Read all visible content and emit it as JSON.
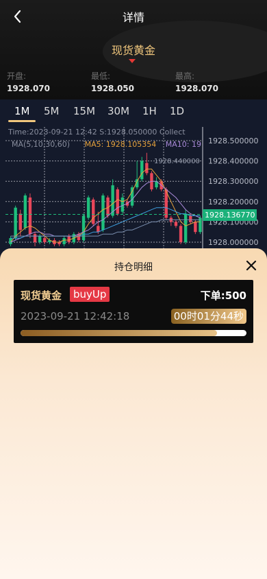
{
  "header": {
    "title": "详情",
    "product": "现货黄金",
    "stats": [
      {
        "label": "开盘:",
        "value": "1928.070"
      },
      {
        "label": "最低:",
        "value": "1928.050"
      },
      {
        "label": "最高:",
        "value": "1928.070"
      }
    ]
  },
  "timeframes": [
    "1M",
    "5M",
    "15M",
    "30M",
    "1H",
    "1D"
  ],
  "active_timeframe": "1M",
  "kline_info": "Time:2023-09-21 12:42    S:1928.050000    Collect",
  "ma_info": {
    "periods": "MA(5,10,30,60)",
    "ma5": "MA5: 1928.105354",
    "ma10": "MA10: 19"
  },
  "chart_data": {
    "type": "candlestick",
    "y_ticks": [
      "1928.500000",
      "1928.400000",
      "1928.300000",
      "1928.200000",
      "1928.100000",
      "1928.000000"
    ],
    "ylim": [
      1928.0,
      1928.5
    ],
    "current_price": "1928.136770",
    "peak_label": "1928.440000",
    "candles": [
      {
        "o": 1927.99,
        "c": 1928.02,
        "h": 1928.03,
        "l": 1927.98
      },
      {
        "o": 1928.02,
        "c": 1928.17,
        "h": 1928.18,
        "l": 1928.01
      },
      {
        "o": 1928.14,
        "c": 1928.06,
        "h": 1928.16,
        "l": 1928.03
      },
      {
        "o": 1928.07,
        "c": 1928.23,
        "h": 1928.24,
        "l": 1928.06
      },
      {
        "o": 1928.22,
        "c": 1928.04,
        "h": 1928.24,
        "l": 1928.02
      },
      {
        "o": 1928.04,
        "c": 1928.0,
        "h": 1928.05,
        "l": 1927.98
      },
      {
        "o": 1928.0,
        "c": 1928.03,
        "h": 1928.04,
        "l": 1927.99
      },
      {
        "o": 1928.02,
        "c": 1928.0,
        "h": 1928.03,
        "l": 1927.99
      },
      {
        "o": 1928.0,
        "c": 1928.01,
        "h": 1928.02,
        "l": 1927.99
      },
      {
        "o": 1928.01,
        "c": 1927.99,
        "h": 1928.02,
        "l": 1927.98
      },
      {
        "o": 1928.0,
        "c": 1927.99,
        "h": 1928.01,
        "l": 1927.98
      },
      {
        "o": 1927.99,
        "c": 1928.02,
        "h": 1928.03,
        "l": 1927.98
      },
      {
        "o": 1928.03,
        "c": 1928.0,
        "h": 1928.04,
        "l": 1927.99
      },
      {
        "o": 1928.0,
        "c": 1928.04,
        "h": 1928.05,
        "l": 1927.99
      },
      {
        "o": 1928.04,
        "c": 1928.01,
        "h": 1928.05,
        "l": 1928.0
      },
      {
        "o": 1928.01,
        "c": 1928.13,
        "h": 1928.14,
        "l": 1928.0
      },
      {
        "o": 1928.12,
        "c": 1928.22,
        "h": 1928.23,
        "l": 1928.11
      },
      {
        "o": 1928.21,
        "c": 1928.09,
        "h": 1928.22,
        "l": 1928.08
      },
      {
        "o": 1928.08,
        "c": 1928.05,
        "h": 1928.15,
        "l": 1928.04
      },
      {
        "o": 1928.06,
        "c": 1928.23,
        "h": 1928.24,
        "l": 1928.05
      },
      {
        "o": 1928.22,
        "c": 1928.13,
        "h": 1928.23,
        "l": 1928.12
      },
      {
        "o": 1928.13,
        "c": 1928.28,
        "h": 1928.31,
        "l": 1928.12
      },
      {
        "o": 1928.26,
        "c": 1928.14,
        "h": 1928.27,
        "l": 1928.13
      },
      {
        "o": 1928.15,
        "c": 1928.22,
        "h": 1928.24,
        "l": 1928.14
      },
      {
        "o": 1928.2,
        "c": 1928.18,
        "h": 1928.21,
        "l": 1928.17
      },
      {
        "o": 1928.18,
        "c": 1928.27,
        "h": 1928.28,
        "l": 1928.17
      },
      {
        "o": 1928.27,
        "c": 1928.31,
        "h": 1928.4,
        "l": 1928.26
      },
      {
        "o": 1928.31,
        "c": 1928.4,
        "h": 1928.42,
        "l": 1928.3
      },
      {
        "o": 1928.39,
        "c": 1928.34,
        "h": 1928.44,
        "l": 1928.33
      },
      {
        "o": 1928.34,
        "c": 1928.26,
        "h": 1928.35,
        "l": 1928.25
      },
      {
        "o": 1928.27,
        "c": 1928.3,
        "h": 1928.32,
        "l": 1928.26
      },
      {
        "o": 1928.3,
        "c": 1928.26,
        "h": 1928.31,
        "l": 1928.25
      },
      {
        "o": 1928.26,
        "c": 1928.12,
        "h": 1928.27,
        "l": 1928.11
      },
      {
        "o": 1928.12,
        "c": 1928.1,
        "h": 1928.13,
        "l": 1928.08
      },
      {
        "o": 1928.1,
        "c": 1928.08,
        "h": 1928.11,
        "l": 1928.07
      },
      {
        "o": 1928.08,
        "c": 1928.0,
        "h": 1928.09,
        "l": 1927.99
      },
      {
        "o": 1928.0,
        "c": 1928.14,
        "h": 1928.16,
        "l": 1927.99
      },
      {
        "o": 1928.13,
        "c": 1928.1,
        "h": 1928.14,
        "l": 1928.09
      },
      {
        "o": 1928.1,
        "c": 1928.05,
        "h": 1928.11,
        "l": 1928.04
      },
      {
        "o": 1928.05,
        "c": 1928.12,
        "h": 1928.13,
        "l": 1928.04
      }
    ],
    "ma_lines": [
      {
        "name": "MA5",
        "color": "#e6a23c",
        "values": [
          1928.0,
          1928.03,
          1928.05,
          1928.07,
          1928.08,
          1928.07,
          1928.05,
          1928.03,
          1928.01,
          1928.0,
          1928.0,
          1928.01,
          1928.01,
          1928.02,
          1928.03,
          1928.05,
          1928.09,
          1928.12,
          1928.14,
          1928.16,
          1928.17,
          1928.19,
          1928.21,
          1928.2,
          1928.21,
          1928.25,
          1928.3,
          1928.34,
          1928.36,
          1928.36,
          1928.33,
          1928.3,
          1928.25,
          1928.2,
          1928.15,
          1928.1,
          1928.08,
          1928.09,
          1928.1,
          1928.1
        ]
      },
      {
        "name": "MA10",
        "color": "#a98ad8",
        "values": [
          1928.0,
          1928.01,
          1928.02,
          1928.03,
          1928.04,
          1928.05,
          1928.05,
          1928.04,
          1928.04,
          1928.03,
          1928.03,
          1928.03,
          1928.03,
          1928.03,
          1928.04,
          1928.05,
          1928.06,
          1928.08,
          1928.1,
          1928.11,
          1928.13,
          1928.15,
          1928.17,
          1928.18,
          1928.19,
          1928.21,
          1928.24,
          1928.27,
          1928.29,
          1928.3,
          1928.3,
          1928.28,
          1928.26,
          1928.24,
          1928.22,
          1928.19,
          1928.16,
          1928.14,
          1928.13,
          1928.12
        ]
      },
      {
        "name": "MA30",
        "color": "#3fa0e0",
        "values": [
          1928.02,
          1928.02,
          1928.02,
          1928.03,
          1928.03,
          1928.03,
          1928.03,
          1928.03,
          1928.03,
          1928.03,
          1928.03,
          1928.03,
          1928.03,
          1928.03,
          1928.03,
          1928.04,
          1928.04,
          1928.05,
          1928.05,
          1928.06,
          1928.07,
          1928.08,
          1928.09,
          1928.1,
          1928.11,
          1928.12,
          1928.13,
          1928.14,
          1928.15,
          1928.16,
          1928.17,
          1928.17,
          1928.17,
          1928.16,
          1928.15,
          1928.14,
          1928.14,
          1928.13,
          1928.13,
          1928.13
        ]
      },
      {
        "name": "MA60",
        "color": "#7b8fb0",
        "values": [
          1928.03,
          1928.03,
          1928.03,
          1928.03,
          1928.03,
          1928.03,
          1928.03,
          1928.03,
          1928.03,
          1928.03,
          1928.03,
          1928.03,
          1928.03,
          1928.03,
          1928.03,
          1928.03,
          1928.03,
          1928.03,
          1928.03,
          1928.04,
          1928.04,
          1928.04,
          1928.05,
          1928.05,
          1928.06,
          1928.06,
          1928.07,
          1928.08,
          1928.09,
          1928.1,
          1928.1,
          1928.11,
          1928.11,
          1928.11,
          1928.11,
          1928.11,
          1928.11,
          1928.11,
          1928.11,
          1928.11
        ]
      }
    ],
    "up_color": "#1fbf7c",
    "down_color": "#e8475a"
  },
  "sheet": {
    "title": "持仓明细",
    "position": {
      "product": "现货黄金",
      "direction": "buyUp",
      "order_label": "下单:",
      "order_value": "500",
      "time": "2023-09-21 12:42:18",
      "countdown": "00时01分44秒",
      "progress": 0.87
    }
  }
}
